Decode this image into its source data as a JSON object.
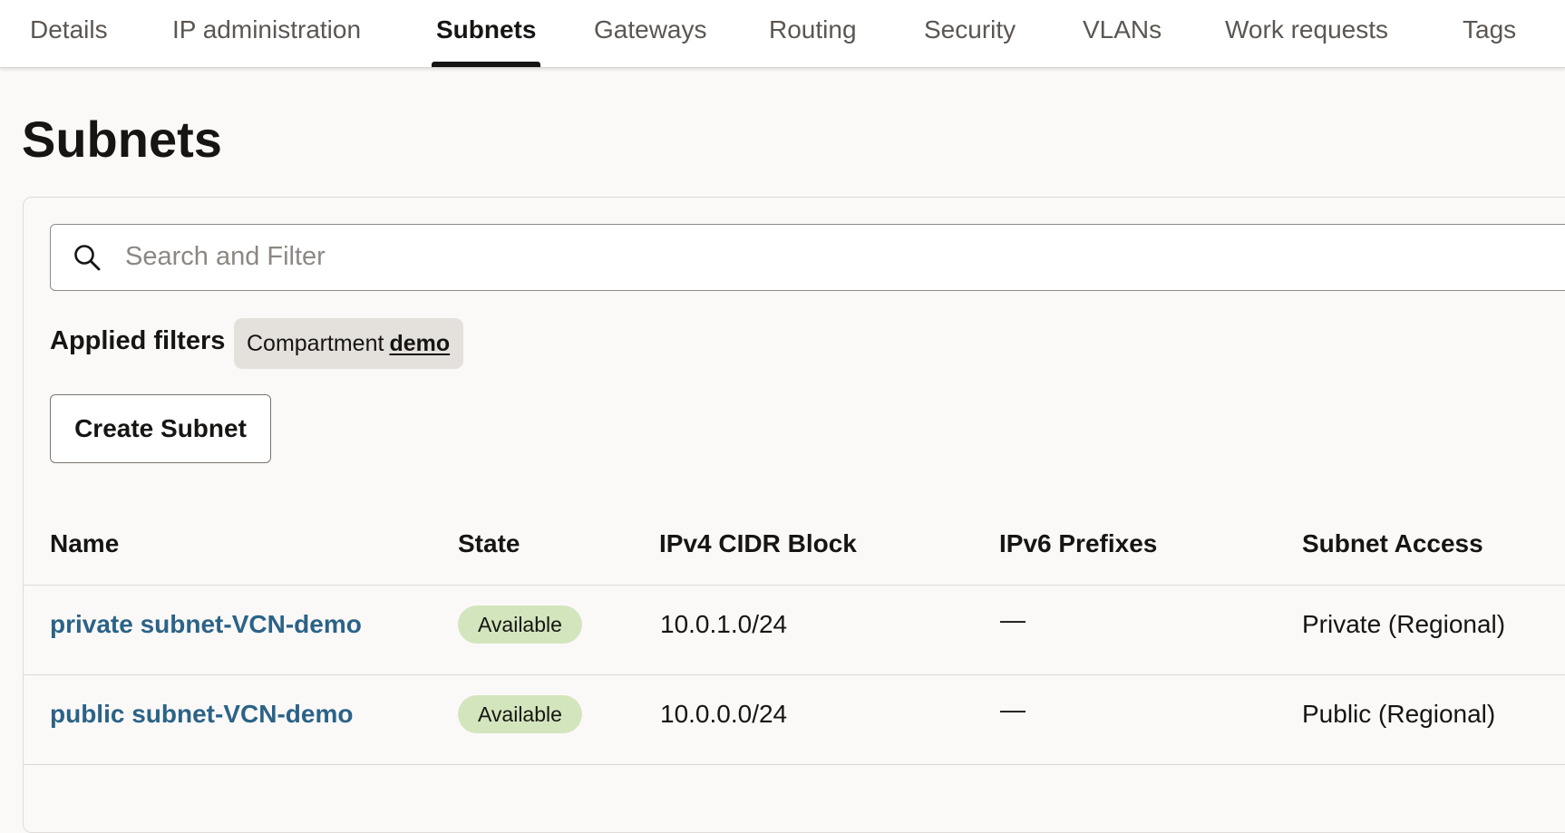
{
  "tabs": [
    {
      "label": "Details",
      "active": false
    },
    {
      "label": "IP administration",
      "active": false
    },
    {
      "label": "Subnets",
      "active": true
    },
    {
      "label": "Gateways",
      "active": false
    },
    {
      "label": "Routing",
      "active": false
    },
    {
      "label": "Security",
      "active": false
    },
    {
      "label": "VLANs",
      "active": false
    },
    {
      "label": "Work requests",
      "active": false
    },
    {
      "label": "Tags",
      "active": false
    }
  ],
  "page": {
    "title": "Subnets"
  },
  "search": {
    "placeholder": "Search and Filter",
    "value": "",
    "icon": "search-icon"
  },
  "filters": {
    "label": "Applied filters",
    "chips": [
      {
        "key": "Compartment",
        "value": "demo"
      }
    ]
  },
  "actions": {
    "create_label": "Create Subnet"
  },
  "table": {
    "columns": [
      "Name",
      "State",
      "IPv4 CIDR Block",
      "IPv6 Prefixes",
      "Subnet Access"
    ],
    "rows": [
      {
        "name": "private subnet-VCN-demo",
        "state": "Available",
        "ipv4": "10.0.1.0/24",
        "ipv6": "—",
        "access": "Private (Regional)"
      },
      {
        "name": "public subnet-VCN-demo",
        "state": "Available",
        "ipv4": "10.0.0.0/24",
        "ipv6": "—",
        "access": "Public (Regional)"
      }
    ]
  },
  "colors": {
    "link": "#2b6387",
    "badge_available": "#d3e5bd",
    "page_bg": "#fbf9f8",
    "active_tab_indicator": "#161513"
  }
}
